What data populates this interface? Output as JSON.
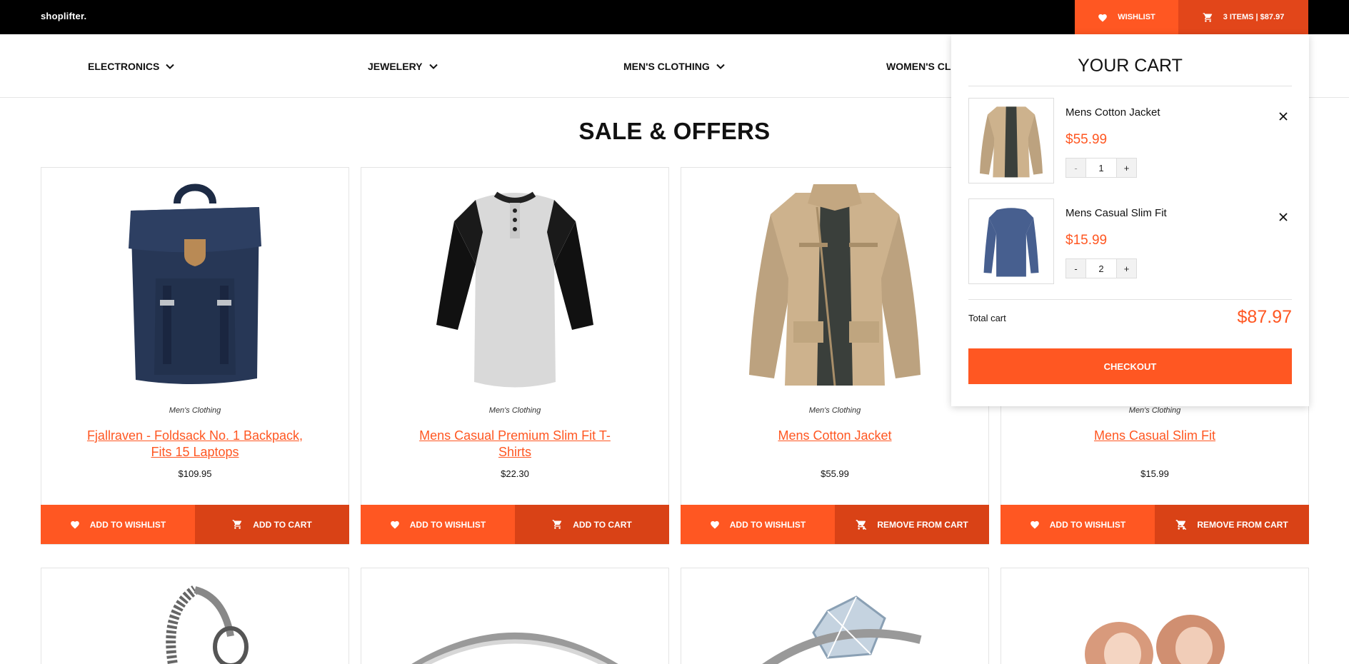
{
  "header": {
    "logo": "shoplifter.",
    "wishlist_label": "WISHLIST",
    "cart_label": "3 ITEMS | $87.97"
  },
  "nav": {
    "items": [
      {
        "label": "ELECTRONICS"
      },
      {
        "label": "JEWELERY"
      },
      {
        "label": "MEN'S CLOTHING"
      },
      {
        "label": "WOMEN'S CLO"
      }
    ]
  },
  "section_title": "SALE & OFFERS",
  "products": [
    {
      "category": "Men's Clothing",
      "title": "Fjallraven - Foldsack No. 1 Backpack, Fits 15 Laptops",
      "price": "$109.95",
      "wishlist_label": "ADD TO WISHLIST",
      "cart_label": "ADD TO CART",
      "cart_icon": "cart-icon"
    },
    {
      "category": "Men's Clothing",
      "title": "Mens Casual Premium Slim Fit T-Shirts",
      "price": "$22.30",
      "wishlist_label": "ADD TO WISHLIST",
      "cart_label": "ADD TO CART",
      "cart_icon": "cart-icon"
    },
    {
      "category": "Men's Clothing",
      "title": "Mens Cotton Jacket",
      "price": "$55.99",
      "wishlist_label": "ADD TO WISHLIST",
      "cart_label": "REMOVE FROM CART",
      "cart_icon": "cart-remove-icon"
    },
    {
      "category": "Men's Clothing",
      "title": "Mens Casual Slim Fit",
      "price": "$15.99",
      "wishlist_label": "ADD TO WISHLIST",
      "cart_label": "REMOVE FROM CART",
      "cart_icon": "cart-remove-icon"
    }
  ],
  "cart": {
    "title": "YOUR CART",
    "items": [
      {
        "name": "Mens Cotton Jacket",
        "price": "$55.99",
        "qty": "1",
        "minus": "-",
        "plus": "+"
      },
      {
        "name": "Mens Casual Slim Fit",
        "price": "$15.99",
        "qty": "2",
        "minus": "-",
        "plus": "+"
      }
    ],
    "total_label": "Total cart",
    "total_value": "$87.97",
    "checkout_label": "CHECKOUT"
  },
  "colors": {
    "accent": "#ff5722",
    "accent_dark": "#d94216",
    "topbar": "#000000"
  }
}
